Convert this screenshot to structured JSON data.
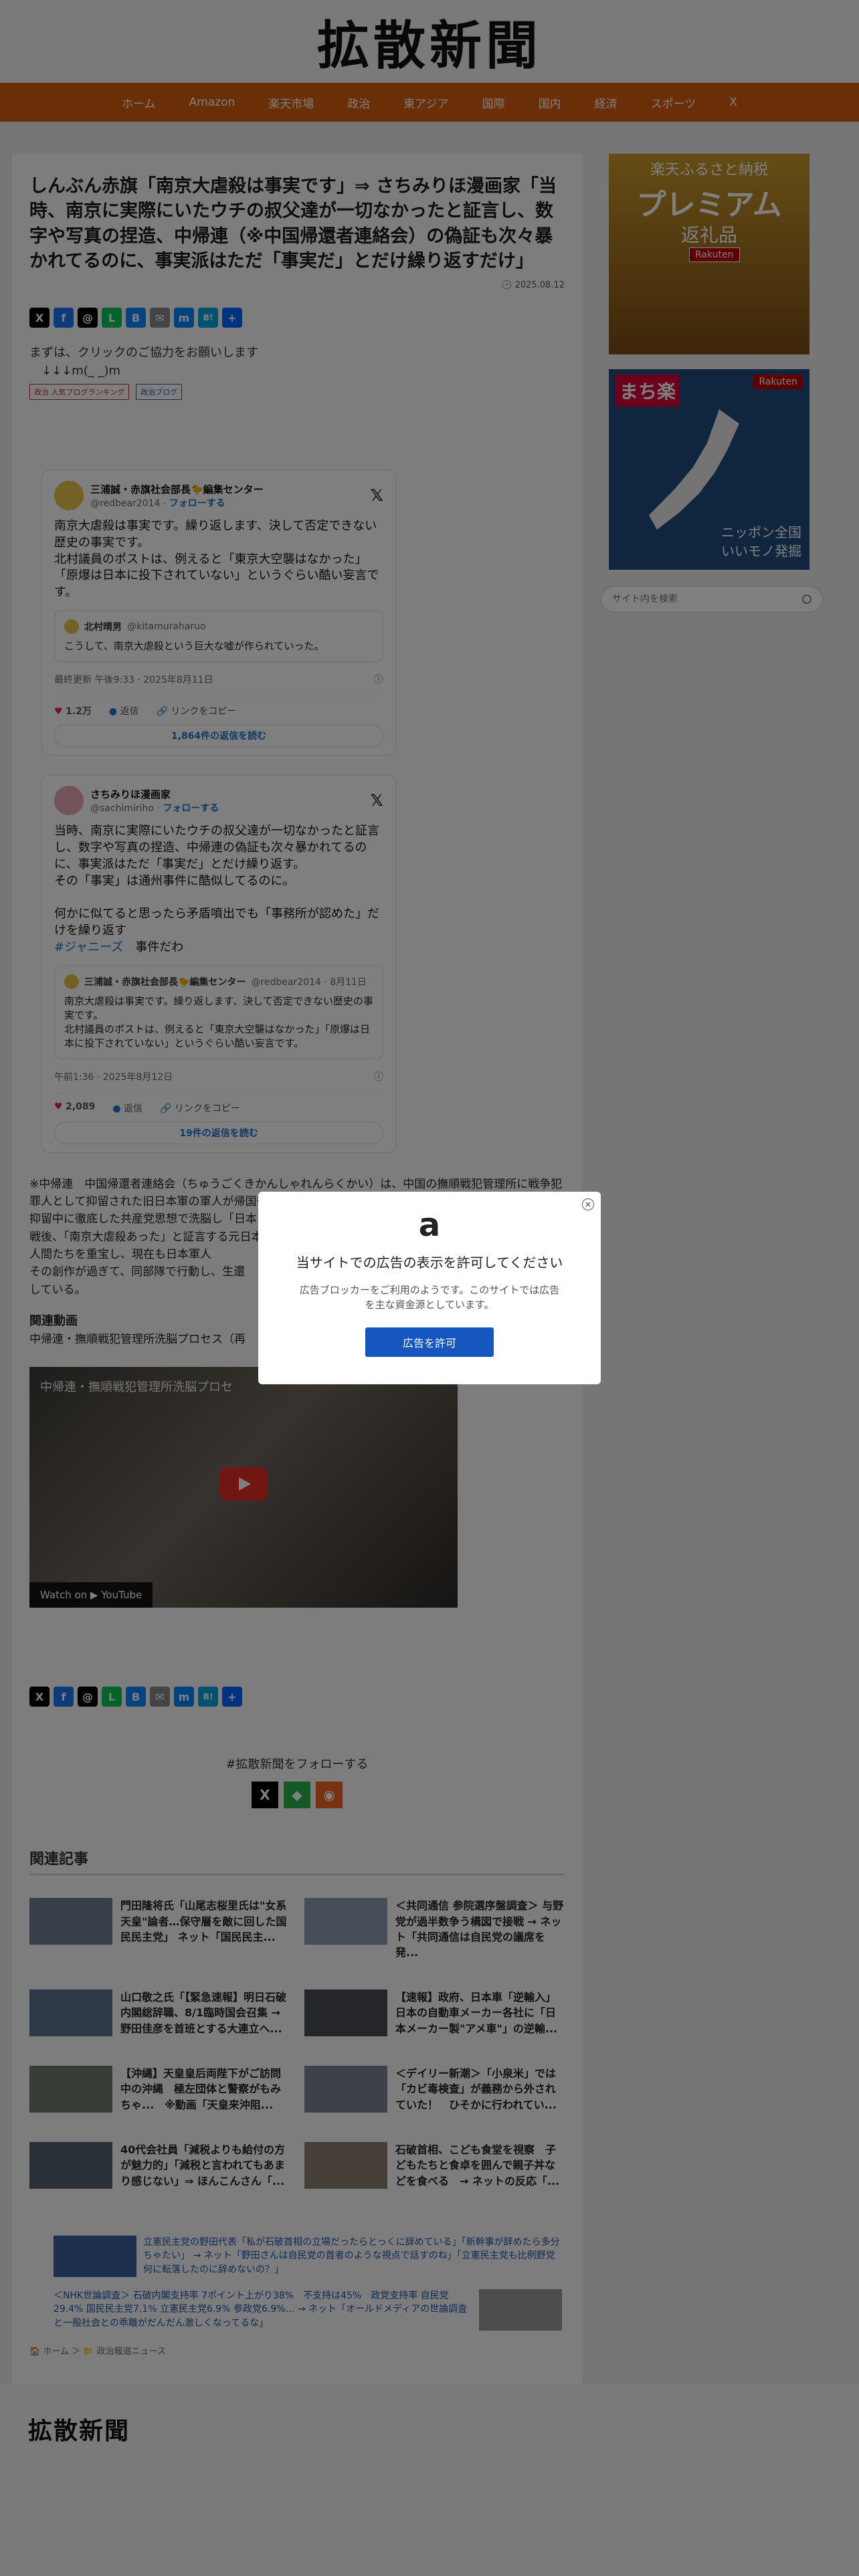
{
  "site": {
    "logo": "拡散新聞"
  },
  "nav": [
    "ホーム",
    "Amazon",
    "楽天市場",
    "政治",
    "東アジア",
    "国際",
    "国内",
    "経済",
    "スポーツ",
    "X"
  ],
  "post": {
    "title": "しんぶん赤旗「南京大虐殺は事実です」⇒ さちみりほ漫画家「当時、南京に実際にいたウチの叔父達が一切なかったと証言し、数字や写真の捏造、中帰連（※中国帰還者連絡会）の偽証も次々暴かれてるのに、事実派はただ「事実だ」とだけ繰り返すだけ」",
    "date": "2025.08.12",
    "intro_line1": "まずは、クリックのご協力をお願いします",
    "intro_line2": "↓↓↓m(_ _)m",
    "badge1": "政治 人気ブログランキング",
    "badge2": "政治ブログ"
  },
  "share": [
    {
      "icon": "x-icon",
      "glyph": "X",
      "color": "#000000"
    },
    {
      "icon": "facebook-icon",
      "glyph": "f",
      "color": "#1877f2"
    },
    {
      "icon": "threads-icon",
      "glyph": "@",
      "color": "#000000"
    },
    {
      "icon": "line-icon",
      "glyph": "L",
      "color": "#06c755"
    },
    {
      "icon": "bluesky-icon",
      "glyph": "B",
      "color": "#1185fe"
    },
    {
      "icon": "email-icon",
      "glyph": "✉",
      "color": "#888888"
    },
    {
      "icon": "messenger-icon",
      "glyph": "m",
      "color": "#0084ff"
    },
    {
      "icon": "hatena-icon",
      "glyph": "B!",
      "color": "#00a4de"
    },
    {
      "icon": "plus-icon",
      "glyph": "+",
      "color": "#0166ff"
    }
  ],
  "tweet1": {
    "name": "三浦誠・赤旗社会部長🐤編集センター",
    "handle": "@redbear2014",
    "follow": "フォローする",
    "body": "南京大虐殺は事実です。繰り返します、決して否定できない歴史の事実です。\n北村議員のポストは、例えると「東京大空襲はなかった」「原爆は日本に投下されていない」というぐらい酷い妄言です。",
    "quote_name": "北村晴男",
    "quote_handle": "@kitamuraharuo",
    "quote_body": "こうして、南京大虐殺という巨大な嘘が作られていった。",
    "meta": "最終更新 午後9:33 · 2025年8月11日",
    "likes": "1.2万",
    "reply": "返信",
    "copy": "リンクをコピー",
    "read": "1,864件の返信を読む"
  },
  "tweet2": {
    "name": "さちみりほ漫画家",
    "handle": "@sachimiriho",
    "follow": "フォローする",
    "body": "当時、南京に実際にいたウチの叔父達が一切なかったと証言し、数字や写真の捏造、中帰連の偽証も次々暴かれてるのに、事実派はただ「事実だ」とだけ繰り返す。\nその「事実」は通州事件に酷似してるのに。\n\n何かに似てると思ったら矛盾噴出でも「事務所が認めた」だけを繰り返す",
    "tag": "#ジャニーズ",
    "tag_after": "事件だわ",
    "quote_name": "三浦誠・赤旗社会部長🐤編集センター",
    "quote_handle": "@redbear2014 · 8月11日",
    "quote_body": "南京大虐殺は事実です。繰り返します、決して否定できない歴史の事実です。\n北村議員のポストは、例えると「東京大空襲はなかった」「原爆は日本に投下されていない」というぐらい酷い妄言です。",
    "meta": "午前1:36 · 2025年8月12日",
    "likes": "2,089",
    "reply": "返信",
    "copy": "リンクをコピー",
    "read": "19件の返信を読む"
  },
  "body": {
    "p1": "※中帰連　中国帰還者連絡会（ちゅうごくきかんしゃれんらくかい）は、中国の撫順戦犯管理所に戦争犯罪人として抑留された旧日本軍の軍人が帰国後の1957年9月24日に結成した団体。",
    "p2": "抑留中に徹底した共産党思想で洗脳し「日本は中国で悪いことをした」と刷り込んだ。",
    "p3": "戦後、「南京大虐殺あった」と証言する元日本軍人はこの中帰連の人間たちで、マスコミもこの中帰連の人間たちを重宝し、現在も日本軍人",
    "p4": "その創作が過ぎて、同部隊で行動し、生還",
    "p5": "している。",
    "related_video": "関連動画",
    "video_desc": "中帰連・撫順戦犯管理所洗脳プロセス（再"
  },
  "video": {
    "title": "中帰連・撫順戦犯管理所洗脳プロセ",
    "watch": "Watch on ▶ YouTube"
  },
  "follow": {
    "label": "#拡散新聞をフォローする"
  },
  "related": {
    "heading": "関連記事",
    "items": [
      "門田隆将氏「山尾志桜里氏は\"女系天皇\"論者…保守層を敵に回した国民民主党」 ネット「国民民主...",
      "＜共同通信 参院選序盤調査＞ 与野党が過半数争う構図で接戦 → ネット「共同通信は自民党の議席を発...",
      "山口敬之氏「【緊急速報】明日石破内閣総辞職、8/1臨時国会召集 → 野田佳彦を首班とする大連立へ...",
      "【速報】政府、日本車「逆輸入」 日本の自動車メーカー各社に「日本メーカー製\"アメ車\"」の逆輸...",
      "【沖縄】天皇皇后両陛下がご訪問中の沖縄　極左団体と警察がもみちゃ...　※動画「天皇来沖阻...",
      "＜デイリー新潮＞「小泉米」では「カビ毒検査」が義務から外されていた！　ひそかに行われてい...",
      "40代会社員「減税よりも給付の方が魅力的」「減税と言われてもあまり感じない」⇒ ほんこんさん「...",
      "石破首相、こども食堂を視察　子どもたちと食卓を囲んで親子丼などを食べる　→ ネットの反応「..."
    ]
  },
  "ads": {
    "a1": "立憲民主党の野田代表「私が石破首相の立場だったらとっくに辞めている」「新幹事が辞めたら多分ちゃたい」 → ネット「野田さんは自民党の首者のような視点で話すのね」「立憲民主党も比例野党何に転落したのに辞めないの？」",
    "a2": "＜NHK世論調査＞ 石破内閣支持率 7ポイント上がり38%　不支持は45%　政党支持率 自民党29.4% 国民民主党7.1% 立憲民主党6.9% 参政党6.9%… → ネット「オールドメディアの世論調査と一般社会との乖離がだんだん激しくなってるな」"
  },
  "breadcrumb": "🏠 ホーム ＞ 📁 政治報道ニュース",
  "sidebar": {
    "ad1_t1": "楽天ふるさと納税",
    "ad1_t2": "プレミアム",
    "ad1_t3": "返礼品",
    "ad1_rk": "Rakuten",
    "ad2_tag": "まち楽",
    "ad2_rk": "Rakuten",
    "ad2_cap": "ニッポン全国\nいいモノ発掘",
    "search_placeholder": "サイト内を検索"
  },
  "modal": {
    "logo": "a",
    "title": "当サイトでの広告の表示を許可してください",
    "text": "広告ブロッカーをご利用のようです。このサイトでは広告を主な資金源としています。",
    "button": "広告を許可",
    "close": "×"
  },
  "footer": {
    "logo": "拡散新聞"
  }
}
